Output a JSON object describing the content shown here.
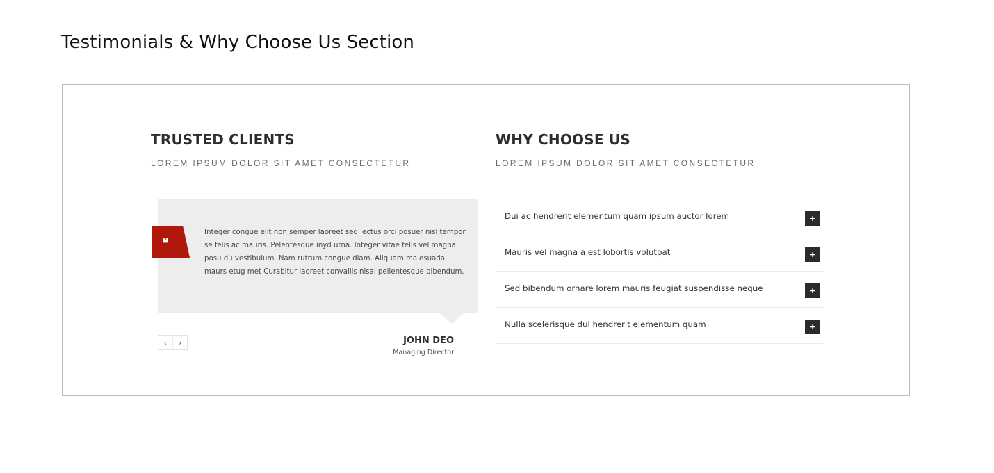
{
  "page": {
    "title": "Testimonials & Why Choose Us Section"
  },
  "testimonials": {
    "heading": "TRUSTED CLIENTS",
    "subheading": "LOREM IPSUM DOLOR SIT AMET CONSECTETUR",
    "quote_icon": "quote-icon",
    "quote_glyph": "❝",
    "quote_text": "Integer congue elit non semper laoreet sed lectus orci posuer nisl tempor se felis ac mauris. Pelentesque inyd urna. Integer vitae felis vel magna posu du vestibulum. Nam rutrum congue diam. Aliquam malesuada maurs etug met Curabitur laoreet convallis nisal pellentesque bibendum.",
    "prev_glyph": "‹",
    "next_glyph": "›",
    "author_name": "JOHN DEO",
    "author_role": "Managing Director",
    "accent_color": "#b0180b"
  },
  "why_choose_us": {
    "heading": "WHY CHOOSE US",
    "subheading": "LOREM IPSUM DOLOR SIT AMET CONSECTETUR",
    "toggle_glyph": "+",
    "items": [
      {
        "label": "Dui ac hendrerit elementum quam ipsum auctor lorem"
      },
      {
        "label": "Mauris vel magna a est lobortis volutpat"
      },
      {
        "label": "Sed bibendum ornare lorem mauris feugiat suspendisse neque"
      },
      {
        "label": "Nulla scelerisque dul hendrerit elementum quam"
      }
    ]
  }
}
